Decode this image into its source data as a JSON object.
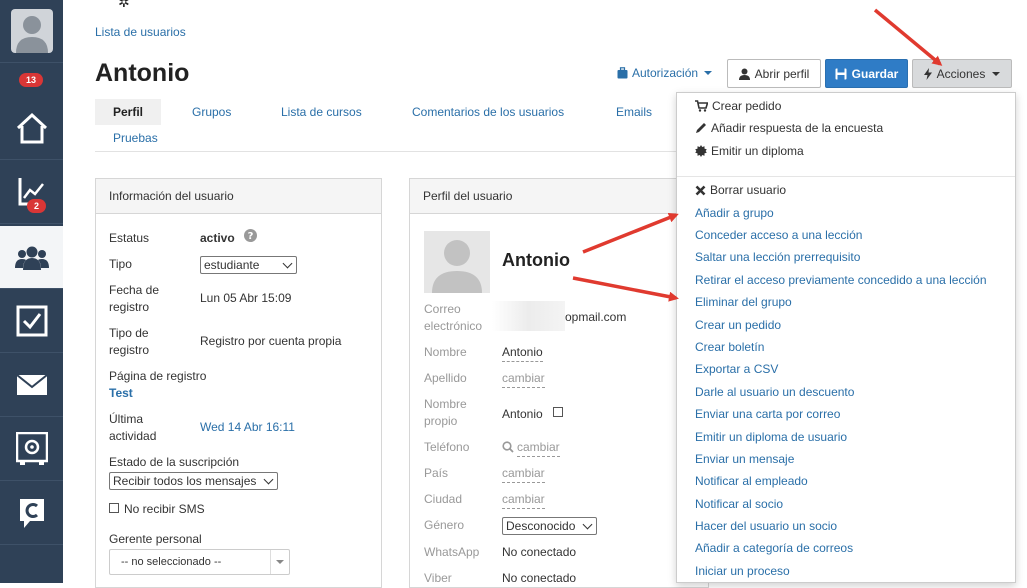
{
  "sidebar": {
    "notifications_badge": "13",
    "analytics_badge": "2"
  },
  "breadcrumb": "Lista de usuarios",
  "page_title": "Antonio",
  "header": {
    "authorization": "Autorización",
    "open_profile": "Abrir perfil",
    "save": "Guardar",
    "actions": "Acciones"
  },
  "tabs": [
    "Perfil",
    "Grupos",
    "Lista de cursos",
    "Comentarios de los usuarios",
    "Emails",
    "Pruebas"
  ],
  "user_info": {
    "title": "Información del usuario",
    "status_label": "Estatus",
    "status_value": "activo",
    "type_label": "Tipo",
    "type_value": "estudiante",
    "reg_date_label_1": "Fecha de",
    "reg_date_label_2": "registro",
    "reg_date_value": "Lun 05 Abr 15:09",
    "reg_type_label_1": "Tipo de",
    "reg_type_label_2": "registro",
    "reg_type_value": "Registro por cuenta propia",
    "reg_page_label": "Página de registro",
    "reg_page_value": "Test",
    "last_activity_label_1": "Última",
    "last_activity_label_2": "actividad",
    "last_activity_value": "Wed 14 Abr 16:11",
    "subscription_label": "Estado de la suscripción",
    "subscription_value": "Recibir todos los mensajes",
    "no_sms_label": "No recibir SMS",
    "manager_label": "Gerente personal",
    "manager_value": "-- no seleccionado --"
  },
  "user_profile": {
    "title": "Perfil del usuario",
    "name_display": "Antonio",
    "email_label_1": "Correo",
    "email_label_2": "electrónico",
    "email_value": "opmail.com",
    "name_label": "Nombre",
    "name_value": "Antonio",
    "surname_label": "Apellido",
    "surname_value": "cambiar",
    "own_name_label_1": "Nombre",
    "own_name_label_2": "propio",
    "own_name_value": "Antonio",
    "phone_label": "Teléfono",
    "phone_value": "cambiar",
    "country_label": "País",
    "country_value": "cambiar",
    "city_label": "Ciudad",
    "city_value": "cambiar",
    "gender_label": "Género",
    "gender_value": "Desconocido",
    "whatsapp_label": "WhatsApp",
    "whatsapp_value": "No conectado",
    "viber_label": "Viber",
    "viber_value": "No conectado"
  },
  "actions_menu": {
    "top": [
      "Crear pedido",
      "Añadir respuesta de la encuesta",
      "Emitir un diploma"
    ],
    "bottom": [
      "Borrar usuario",
      "Añadir a grupo",
      "Conceder acceso a una lección",
      "Saltar una lección prerrequisito",
      "Retirar el acceso previamente concedido a una lección",
      "Eliminar del grupo",
      "Crear un pedido",
      "Crear boletín",
      "Exportar a CSV",
      "Darle al usuario un descuento",
      "Enviar una carta por correo",
      "Emitir un diploma de usuario",
      "Enviar un mensaje",
      "Notificar al empleado",
      "Notificar al socio",
      "Hacer del usuario un socio",
      "Añadir a categoría de correos",
      "Iniciar un proceso"
    ]
  },
  "colors": {
    "sidebar": "#2f4157",
    "link": "#2a6fa8",
    "primary": "#2f7cc6",
    "badge": "#d93636",
    "annotation_arrow": "#e03a2f"
  }
}
